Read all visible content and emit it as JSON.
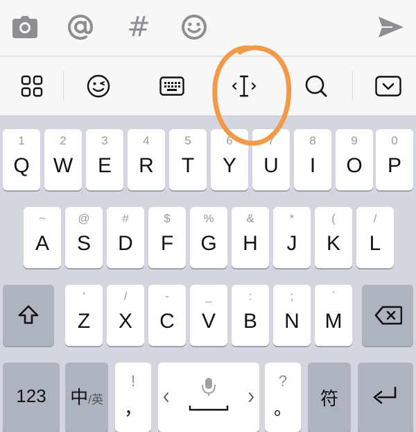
{
  "toolbar": {
    "icons": [
      "camera-icon",
      "at-icon",
      "hash-icon",
      "emoji-icon",
      "send-icon"
    ],
    "hash_label": "#"
  },
  "fnbar": {
    "icons": [
      "grid-icon",
      "wink-emoji-icon",
      "keyboard-icon",
      "cursor-icon",
      "search-icon",
      "collapse-keyboard-icon"
    ],
    "cursor_label": "‹ I ›"
  },
  "annotation_color": "#f39a48",
  "rows": {
    "row1": [
      {
        "sub": "1",
        "main": "Q"
      },
      {
        "sub": "2",
        "main": "W"
      },
      {
        "sub": "3",
        "main": "E"
      },
      {
        "sub": "4",
        "main": "R"
      },
      {
        "sub": "5",
        "main": "T"
      },
      {
        "sub": "6",
        "main": "Y"
      },
      {
        "sub": "7",
        "main": "U"
      },
      {
        "sub": "8",
        "main": "I"
      },
      {
        "sub": "9",
        "main": "O"
      },
      {
        "sub": "0",
        "main": "P"
      }
    ],
    "row2": [
      {
        "sub": "~",
        "main": "A"
      },
      {
        "sub": "@",
        "main": "S"
      },
      {
        "sub": "#",
        "main": "D"
      },
      {
        "sub": "$",
        "main": "F"
      },
      {
        "sub": "%",
        "main": "G"
      },
      {
        "sub": "&",
        "main": "H"
      },
      {
        "sub": "*",
        "main": "J"
      },
      {
        "sub": "(",
        "main": "K"
      },
      {
        "sub": "/",
        "main": "L"
      }
    ],
    "row3": [
      {
        "sub": "'",
        "main": "Z"
      },
      {
        "sub": "/",
        "main": "X"
      },
      {
        "sub": "-",
        "main": "C"
      },
      {
        "sub": "_",
        "main": "V"
      },
      {
        "sub": ":",
        "main": "B"
      },
      {
        "sub": ";",
        "main": "N"
      },
      {
        "sub": "`",
        "main": "M"
      }
    ]
  },
  "bottom": {
    "num_label": "123",
    "lang_main": "中",
    "lang_small": "/英",
    "comma_top": "!",
    "comma_main": "，",
    "period_top": "?",
    "period_main": "。",
    "symbol_label": "符"
  }
}
